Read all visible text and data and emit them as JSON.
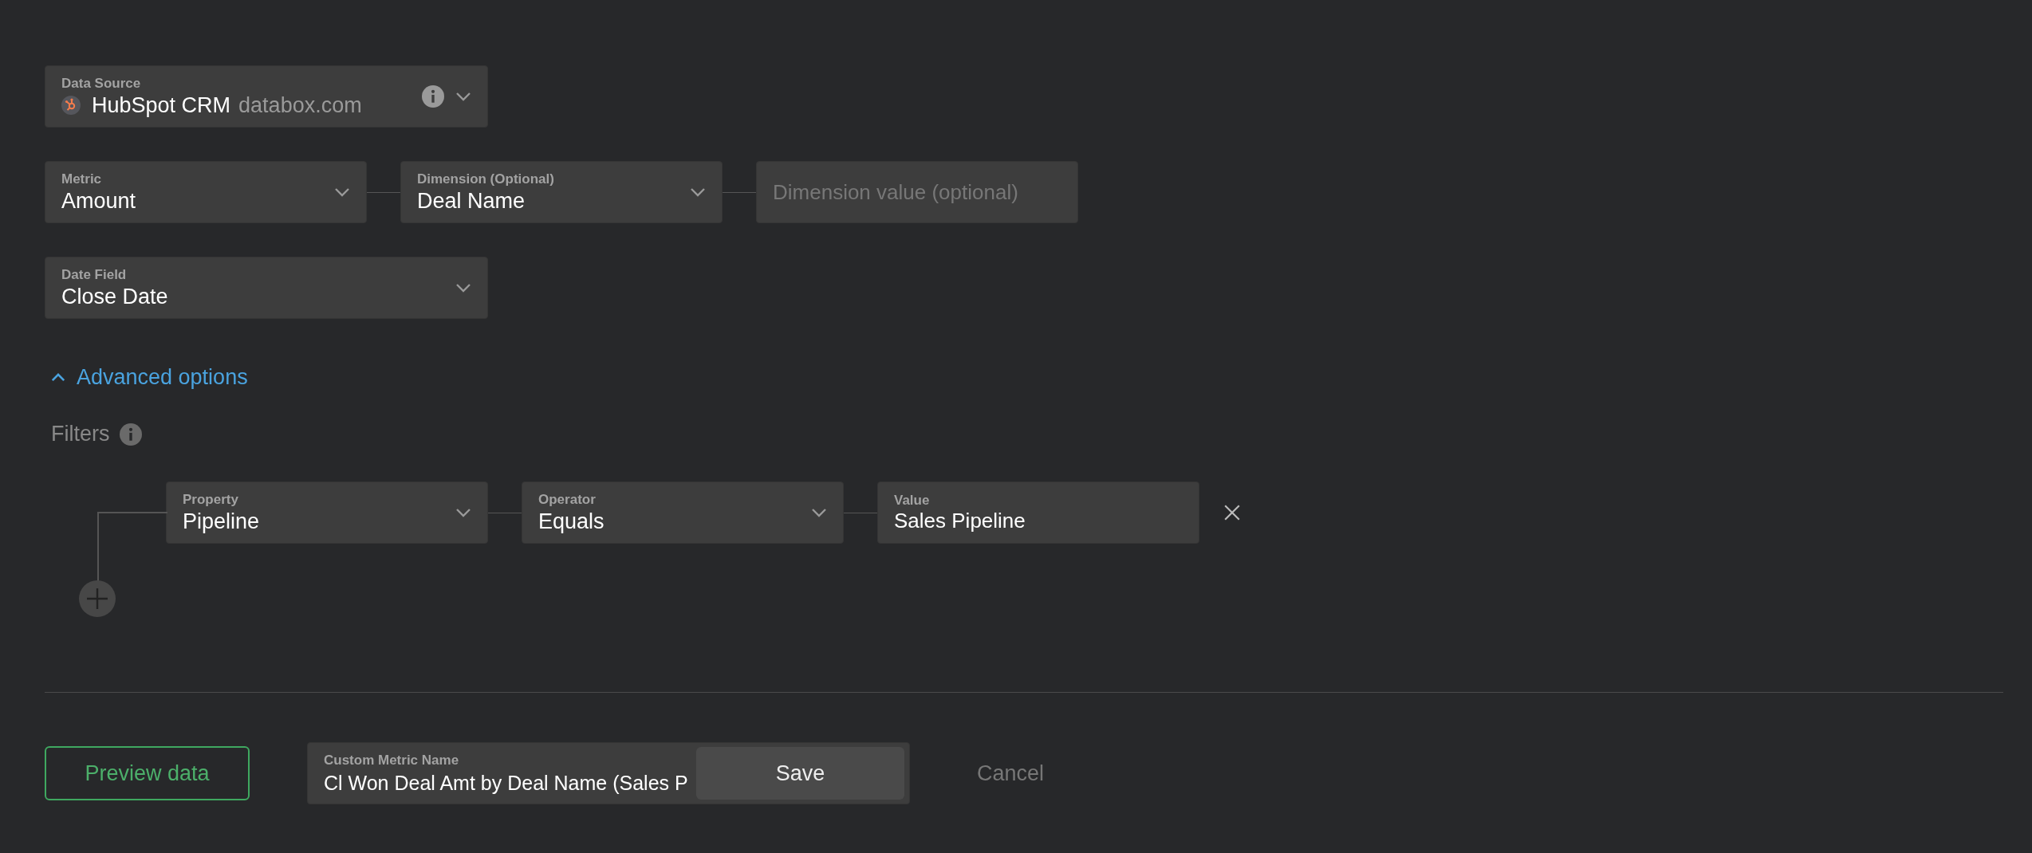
{
  "data_source": {
    "label": "Data Source",
    "value": "HubSpot CRM",
    "account": "databox.com"
  },
  "metric_row": [
    {
      "kind": "select",
      "label": "Metric",
      "value": "Amount"
    },
    {
      "kind": "select",
      "label": "Dimension (Optional)",
      "value": "Deal Name"
    },
    {
      "kind": "text",
      "placeholder": "Dimension value (optional)"
    }
  ],
  "date_field": {
    "label": "Date Field",
    "value": "Close Date"
  },
  "advanced_options": {
    "label": "Advanced options",
    "expanded": true
  },
  "filters": {
    "label": "Filters",
    "rows": [
      {
        "fields": [
          {
            "kind": "select",
            "label": "Property",
            "value": "Pipeline"
          },
          {
            "kind": "select",
            "label": "Operator",
            "value": "Equals"
          },
          {
            "kind": "text",
            "label": "Value",
            "value": "Sales Pipeline"
          }
        ]
      }
    ]
  },
  "footer": {
    "preview_button": "Preview data",
    "name_field": {
      "label": "Custom Metric Name",
      "value": "Cl Won Deal Amt by Deal Name (Sales P"
    },
    "save_button": "Save",
    "cancel_button": "Cancel"
  }
}
